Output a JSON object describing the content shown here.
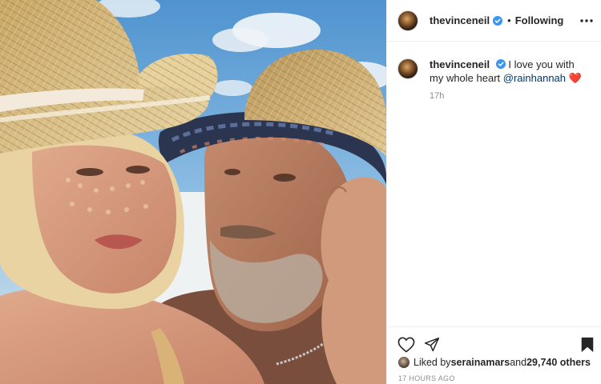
{
  "post": {
    "username": "thevinceneil",
    "follow_status": "Following",
    "separator": "•",
    "more_icon": "more-horizontal-icon",
    "verified_color": "#3897f0"
  },
  "caption": {
    "username": "thevinceneil",
    "text_before": "I love you with my whole heart ",
    "mention": "@rainhannah",
    "emoji": "❤️",
    "timestamp": "17h"
  },
  "actions": {
    "like_icon": "heart-outline-icon",
    "share_icon": "paper-plane-icon",
    "save_icon": "bookmark-filled-icon"
  },
  "likes": {
    "prefix": "Liked by ",
    "first_liker": "serainamars",
    "middle": " and ",
    "count": "29,740 others"
  },
  "posted_ago": "17 HOURS AGO"
}
